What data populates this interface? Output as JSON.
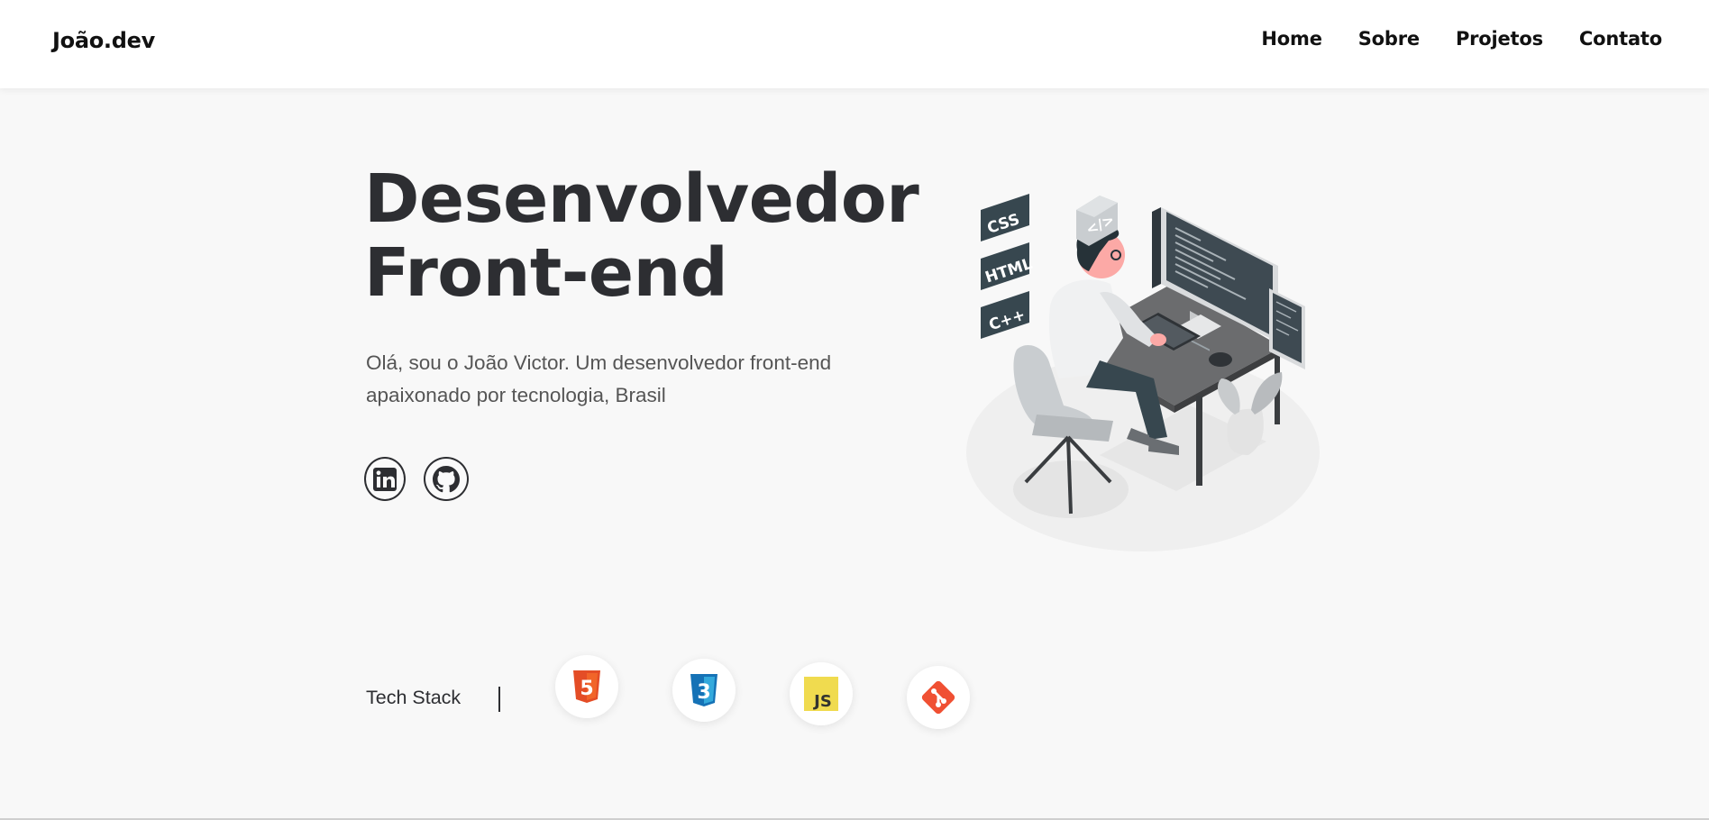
{
  "nav": {
    "logo": "João.dev",
    "links": [
      "Home",
      "Sobre",
      "Projetos",
      "Contato"
    ]
  },
  "hero": {
    "title": "Desenvolvedor\nFront-end",
    "text": "Olá, sou o João Victor. Um desenvolvedor front-end apaixonado por tecnologia, Brasil",
    "social": [
      {
        "name": "linkedin-icon"
      },
      {
        "name": "github-icon"
      }
    ]
  },
  "illustration": {
    "labels": [
      "CSS",
      "HTML",
      "C++"
    ],
    "code_badge": "</>"
  },
  "tech_stack": {
    "label": "Tech Stack",
    "icons": [
      {
        "name": "html5-icon",
        "color": "#e44d26",
        "text": "5"
      },
      {
        "name": "css3-icon",
        "color": "#1572b6",
        "text": "3"
      },
      {
        "name": "javascript-icon",
        "color": "#f0db4f",
        "text": "JS"
      },
      {
        "name": "git-icon",
        "color": "#f05033"
      }
    ]
  },
  "colors": {
    "background": "#f8f8f8",
    "navbar": "#ffffff",
    "title": "#2d2e32",
    "text": "#555555"
  }
}
